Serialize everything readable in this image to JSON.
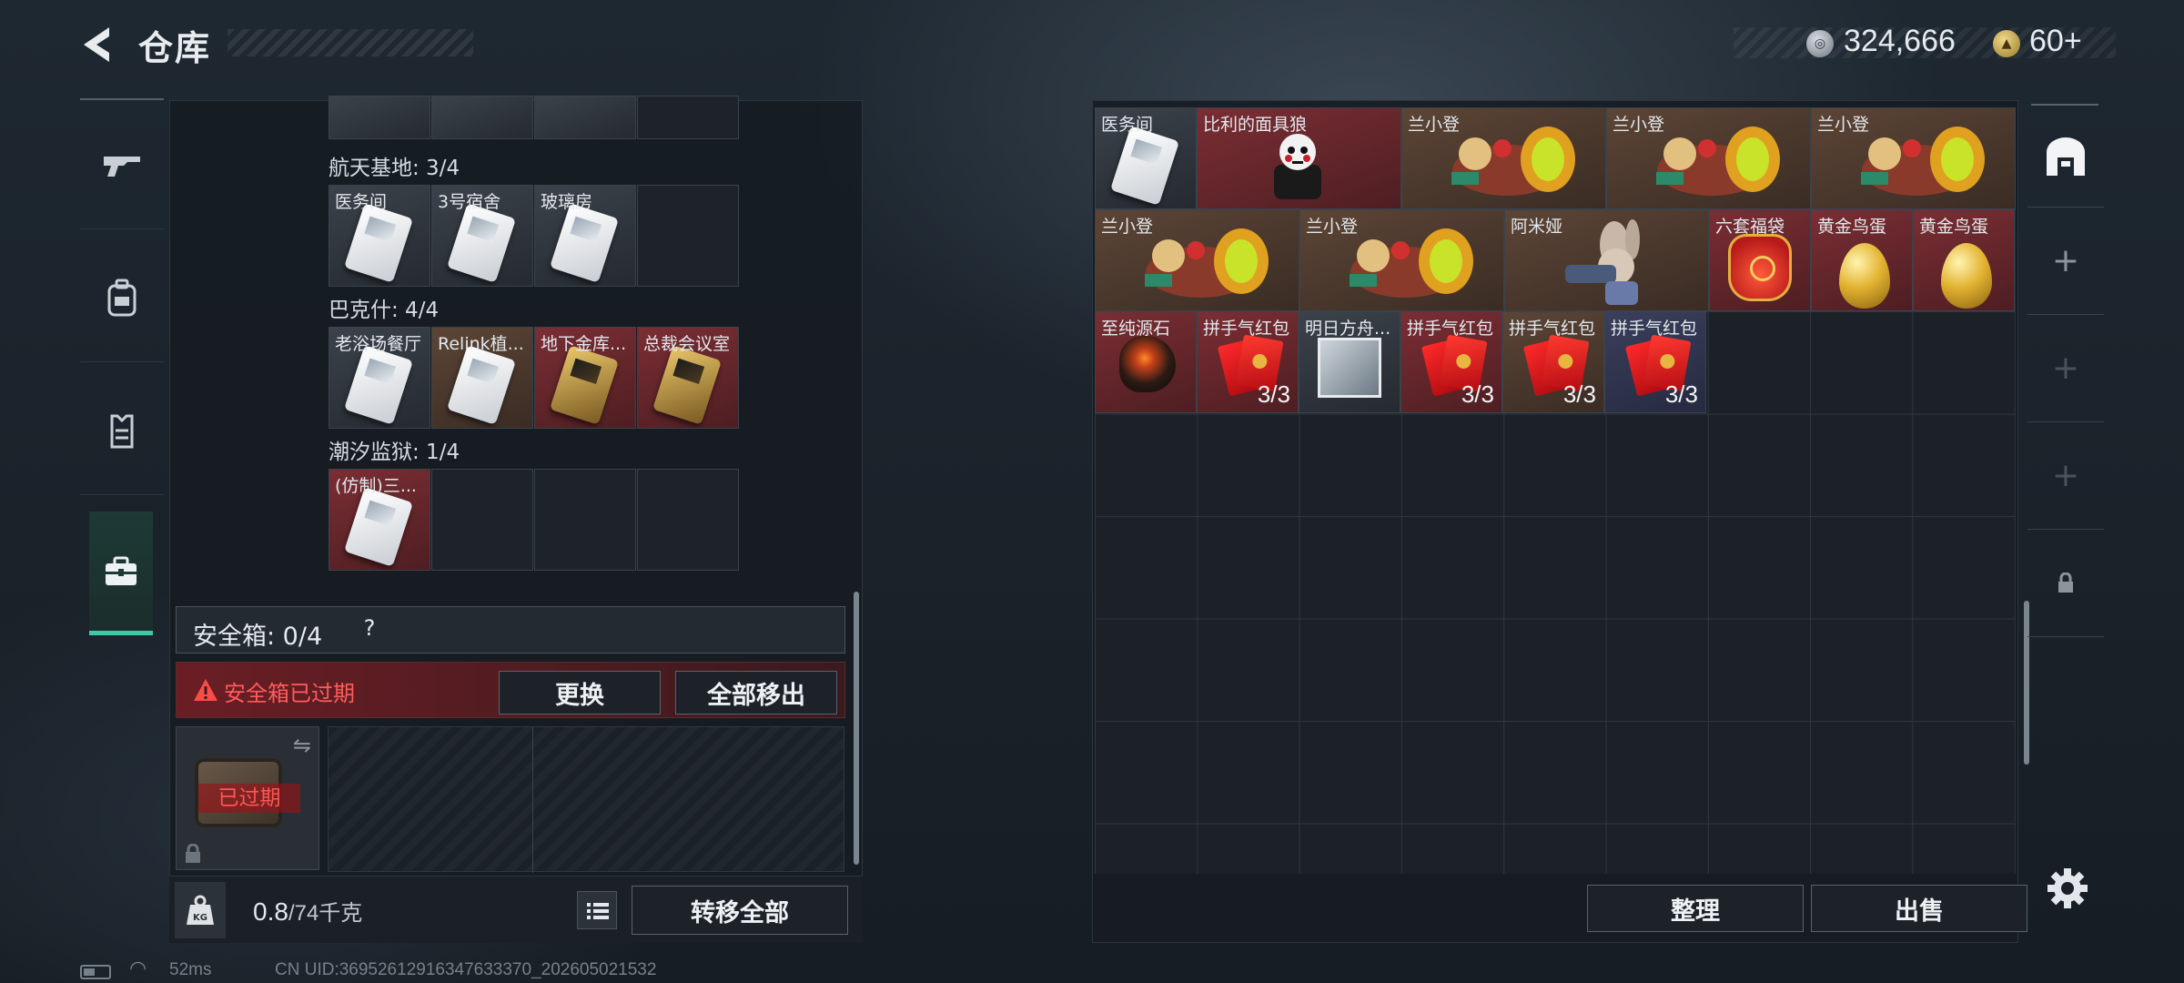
{
  "header": {
    "title": "仓库",
    "currency_silver": "324,666",
    "currency_gold": "60+"
  },
  "left_panel": {
    "sections": [
      {
        "name": "航天基地: 3/4",
        "items": [
          "医务间",
          "3号宿舍",
          "玻璃房",
          ""
        ]
      },
      {
        "name": "巴克什: 4/4",
        "items": [
          "老浴场餐厅",
          "Relink植...",
          "地下金库...",
          "总裁会议室"
        ]
      },
      {
        "name": "潮汐监狱: 1/4",
        "items": [
          "(仿制)三...",
          "",
          "",
          ""
        ]
      }
    ],
    "safe_box": {
      "title": "安全箱:  0/4",
      "help": "?",
      "expired_text": "安全箱已过期",
      "replace_button": "更换",
      "move_all_button": "全部移出",
      "slot_status": "已过期"
    },
    "weight": {
      "current": "0.8",
      "max": "/74千克",
      "kg_icon_label": "KG",
      "transfer_all_button": "转移全部"
    }
  },
  "right_panel": {
    "rows": [
      [
        "医务间",
        "比利的面具狼",
        "兰小登",
        "兰小登",
        "兰小登"
      ],
      [
        "兰小登",
        "兰小登",
        "阿米娅",
        "六套福袋",
        "黄金鸟蛋",
        "黄金鸟蛋"
      ],
      [
        "至纯源石",
        "拼手气红包",
        "明日方舟...",
        "拼手气红包",
        "拼手气红包",
        "拼手气红包"
      ]
    ],
    "counts": {
      "red_packet_1": "3/3",
      "red_packet_2": "3/3",
      "red_packet_3": "3/3",
      "red_packet_4": "3/3"
    },
    "sort_button": "整理",
    "sell_button": "出售"
  },
  "status_bar": {
    "ping": "52ms",
    "uid": "CN UID:3695261291634763337​0_202605021532"
  },
  "colors": {
    "accent_active": "#3ec9a7",
    "warning_red": "#ff5b5b",
    "rarity_grey": "#3c424b",
    "rarity_brown": "#5c4536",
    "rarity_red": "#7a2e34",
    "rarity_blue": "#3a3f5c"
  },
  "icons": [
    "back-arrow-icon",
    "gun-icon",
    "backpack-icon",
    "vest-icon",
    "toolbox-icon",
    "safe-house-icon",
    "plus-icon",
    "lock-icon",
    "gear-icon",
    "list-icon",
    "warning-icon",
    "swap-icon",
    "kg-weight-icon",
    "battery-icon",
    "wifi-icon"
  ]
}
